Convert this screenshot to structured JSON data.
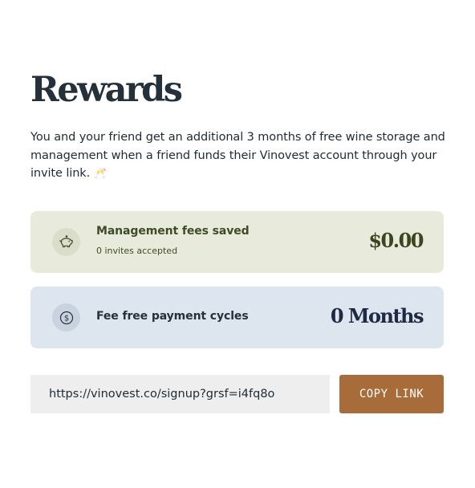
{
  "header": {
    "title": "Rewards"
  },
  "description": {
    "text": "You and your friend get an additional 3 months of free wine storage and management when a friend funds their Vinovest account through your invite link.",
    "emoji": "🥂"
  },
  "cards": {
    "fees": {
      "label": "Management fees saved",
      "subtext": "0 invites accepted",
      "value": "$0.00",
      "icon": "piggy-bank-icon",
      "color": "#e8ebdc"
    },
    "cycles": {
      "label": "Fee free payment cycles",
      "value": "0 Months",
      "icon": "dollar-coin-icon",
      "color": "#dde5ee"
    }
  },
  "invite": {
    "link": "https://vinovest.co/signup?grsf=i4fq8o",
    "copy_label": "COPY LINK",
    "button_color": "#a86c3b"
  }
}
